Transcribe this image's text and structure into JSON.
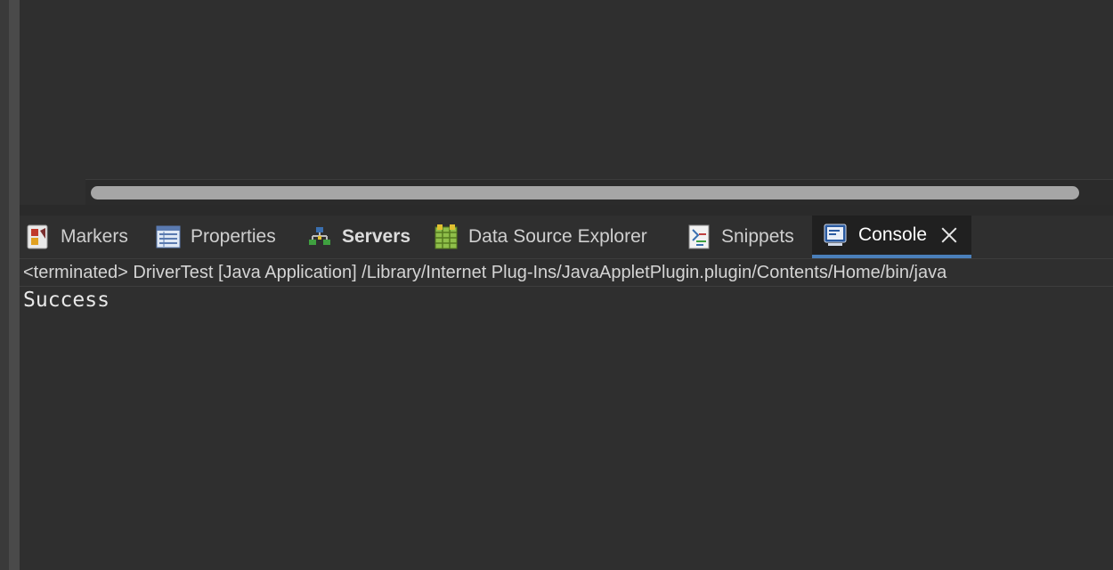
{
  "views": {
    "tabs": [
      {
        "label": "Markers",
        "icon": "markers-icon"
      },
      {
        "label": "Properties",
        "icon": "properties-icon"
      },
      {
        "label": "Servers",
        "icon": "servers-icon"
      },
      {
        "label": "Data Source Explorer",
        "icon": "data-source-explorer-icon"
      },
      {
        "label": "Snippets",
        "icon": "snippets-icon"
      },
      {
        "label": "Console",
        "icon": "console-icon"
      }
    ],
    "active_tab": "Console"
  },
  "console": {
    "status": "<terminated> DriverTest [Java Application] /Library/Internet Plug-Ins/JavaAppletPlugin.plugin/Contents/Home/bin/java",
    "output": "Success"
  },
  "colors": {
    "background": "#2f2f2f",
    "active_tab_underline": "#4a7fba",
    "scroll_thumb": "#a6a6a6"
  }
}
